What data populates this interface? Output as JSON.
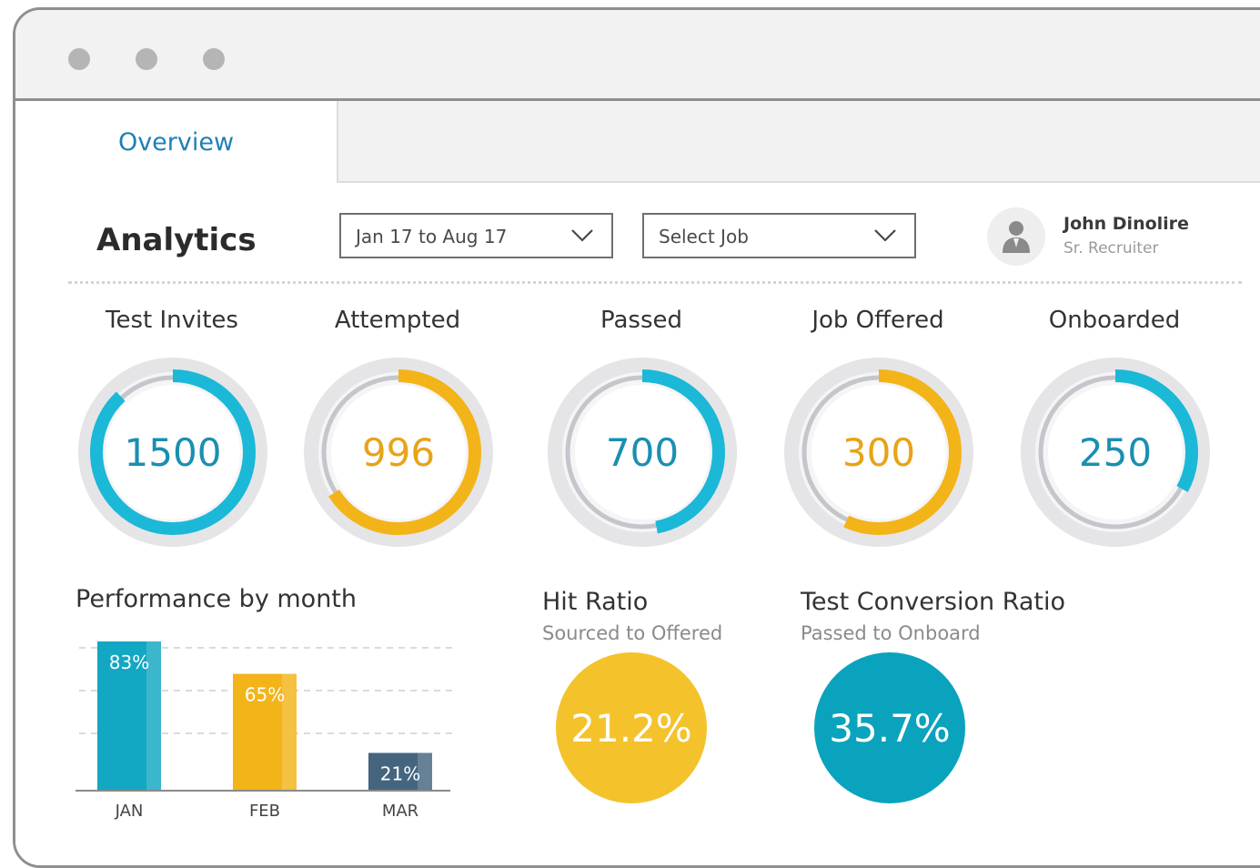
{
  "window": {
    "controls": [
      "close",
      "minimize",
      "maximize"
    ]
  },
  "tabs": [
    {
      "label": "Overview",
      "active": true
    }
  ],
  "header": {
    "title": "Analytics",
    "date_filter": {
      "value": "Jan 17 to Aug 17",
      "icon": "chevron-down-icon"
    },
    "job_filter": {
      "value": "Select Job",
      "icon": "chevron-down-icon"
    },
    "user": {
      "name": "John Dinolire",
      "role": "Sr. Recruiter",
      "icon": "user-avatar-icon"
    }
  },
  "metrics": [
    {
      "label": "Test Invites",
      "value": "1500",
      "progress": 0.88,
      "color": "#1bb8d8",
      "text_color": "#1a8fb1"
    },
    {
      "label": "Attempted",
      "value": "996",
      "progress": 0.66,
      "color": "#f2b418",
      "text_color": "#e8a317"
    },
    {
      "label": "Passed",
      "value": "700",
      "progress": 0.47,
      "color": "#1bb8d8",
      "text_color": "#1a8fb1"
    },
    {
      "label": "Job Offered",
      "value": "300",
      "progress": 0.57,
      "color": "#f2b418",
      "text_color": "#e8a317"
    },
    {
      "label": "Onboarded",
      "value": "250",
      "progress": 0.33,
      "color": "#1bb8d8",
      "text_color": "#1a8fb1"
    }
  ],
  "performance": {
    "title": "Performance by month"
  },
  "chart_data": {
    "type": "bar",
    "title": "Performance by month",
    "categories": [
      "JAN",
      "FEB",
      "MAR"
    ],
    "values": [
      83,
      65,
      21
    ],
    "value_labels": [
      "83%",
      "65%",
      "21%"
    ],
    "colors": [
      "#12a7c3",
      "#f2b418",
      "#45657f"
    ],
    "ylim": [
      0,
      83
    ],
    "grid": true,
    "xlabel": "",
    "ylabel": ""
  },
  "hit_ratio": {
    "title": "Hit Ratio",
    "subtitle": "Sourced to Offered",
    "value": "21.2%",
    "color": "#f4c22b"
  },
  "conversion_ratio": {
    "title": "Test Conversion Ratio",
    "subtitle": "Passed to Onboard",
    "value": "35.7%",
    "color": "#0aa3bd"
  }
}
